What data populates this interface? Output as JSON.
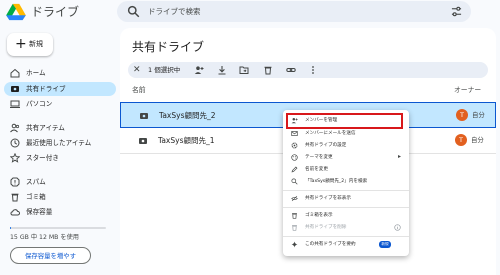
{
  "header": {
    "app_title": "ドライブ",
    "search_placeholder": "ドライブで検索"
  },
  "sidebar": {
    "new_label": "新規",
    "items": [
      {
        "label": "ホーム",
        "icon": "home-icon"
      },
      {
        "label": "共有ドライブ",
        "icon": "shared-drive-icon",
        "active": true
      },
      {
        "label": "パソコン",
        "icon": "computer-icon"
      },
      {
        "label": "共有アイテム",
        "icon": "people-icon"
      },
      {
        "label": "最近使用したアイテム",
        "icon": "clock-icon"
      },
      {
        "label": "スター付き",
        "icon": "star-icon"
      },
      {
        "label": "スパム",
        "icon": "spam-icon"
      },
      {
        "label": "ゴミ箱",
        "icon": "trash-icon"
      },
      {
        "label": "保存容量",
        "icon": "cloud-icon"
      }
    ],
    "storage_text": "15 GB 中 12 MB を使用",
    "storage_fraction": 0.01,
    "buy_storage_label": "保存容量を増やす"
  },
  "main": {
    "title": "共有ドライブ",
    "selection_count": "1 個選択中",
    "columns": {
      "name": "名前",
      "owner": "オーナー"
    },
    "rows": [
      {
        "name": "TaxSys顧問先_2",
        "owner": "自分",
        "avatar": "T",
        "selected": true
      },
      {
        "name": "TaxSys顧問先_1",
        "owner": "自分",
        "avatar": "T",
        "selected": false
      }
    ]
  },
  "context_menu": {
    "items": [
      {
        "label": "メンバーを管理",
        "icon": "person-add-icon"
      },
      {
        "label": "メンバーにメールを送信",
        "icon": "mail-icon"
      },
      {
        "label": "共有ドライブの設定",
        "icon": "settings-icon"
      },
      {
        "label": "テーマを変更",
        "icon": "palette-icon",
        "submenu": true
      },
      {
        "label": "名前を変更",
        "icon": "edit-icon"
      },
      {
        "label": "「TaxSys顧問先_2」内を検索",
        "icon": "search-icon"
      },
      {
        "label": "共有ドライブを非表示",
        "icon": "hide-icon"
      },
      {
        "label": "ゴミ箱を表示",
        "icon": "trash-icon"
      },
      {
        "label": "共有ドライブを削除",
        "icon": "delete-icon",
        "disabled": true
      },
      {
        "label": "この共有ドライブを要約",
        "icon": "sparkle-icon",
        "badge": "新規"
      }
    ]
  },
  "colors": {
    "accent": "#0b57d0",
    "selection": "#c2e7ff",
    "highlight": "#d8181b",
    "avatar": "#e2601f"
  }
}
